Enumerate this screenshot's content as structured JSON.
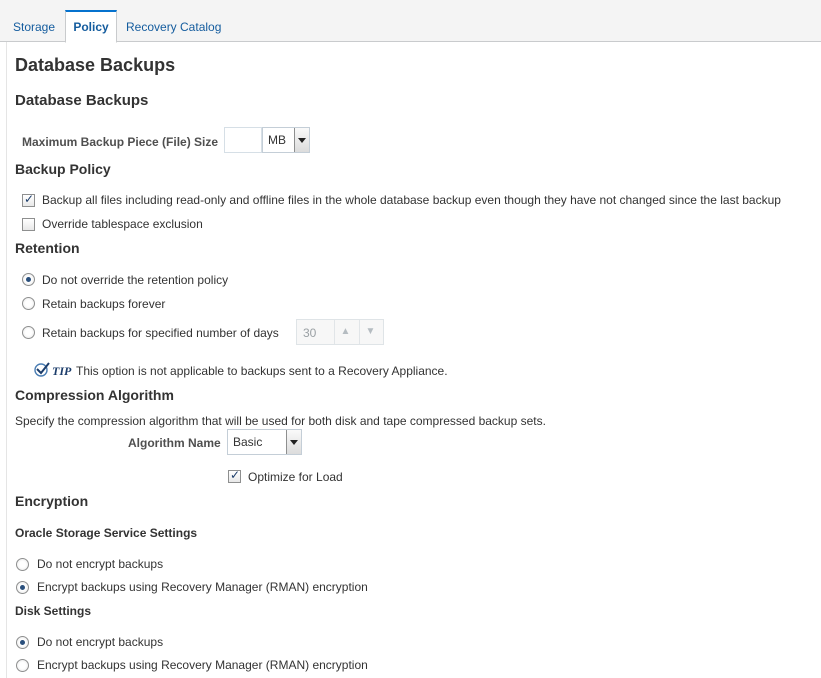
{
  "tabs": [
    {
      "label": "Storage",
      "active": false
    },
    {
      "label": "Policy",
      "active": true
    },
    {
      "label": "Recovery Catalog",
      "active": false
    }
  ],
  "page_title": "Database Backups",
  "section_title": "Database Backups",
  "max_piece": {
    "label": "Maximum Backup Piece (File) Size",
    "value": "",
    "unit": "MB"
  },
  "backup_policy": {
    "title": "Backup Policy",
    "backup_all": {
      "label": "Backup all files including read-only and offline files in the whole database backup even though they have not changed since the last backup",
      "checked": true
    },
    "override_tablespace": {
      "label": "Override tablespace exclusion",
      "checked": false
    }
  },
  "retention": {
    "title": "Retention",
    "options": [
      {
        "label": "Do not override the retention policy",
        "selected": true
      },
      {
        "label": "Retain backups forever",
        "selected": false
      },
      {
        "label": "Retain backups for specified number of days",
        "selected": false
      }
    ],
    "days_value": "30",
    "tip_label": "TIP",
    "tip_text": "This option is not applicable to backups sent to a Recovery Appliance."
  },
  "compression": {
    "title": "Compression Algorithm",
    "description": "Specify the compression algorithm that will be used for both disk and tape compressed backup sets.",
    "algorithm_label": "Algorithm Name",
    "algorithm_value": "Basic",
    "optimize": {
      "label": "Optimize for Load",
      "checked": true
    }
  },
  "encryption": {
    "title": "Encryption",
    "oracle_storage": {
      "title": "Oracle Storage Service Settings",
      "options": [
        {
          "label": "Do not encrypt backups",
          "selected": false
        },
        {
          "label": "Encrypt backups using Recovery Manager (RMAN) encryption",
          "selected": true
        }
      ]
    },
    "disk": {
      "title": "Disk Settings",
      "options": [
        {
          "label": "Do not encrypt backups",
          "selected": true
        },
        {
          "label": "Encrypt backups using Recovery Manager (RMAN) encryption",
          "selected": false
        }
      ]
    }
  },
  "colors": {
    "tab_link": "#145c9e",
    "tab_active_border": "#0572ce",
    "radio_selected": "#2a4f7c"
  },
  "icons": {
    "tip": "tip-check-icon",
    "dropdown": "chevron-down-icon",
    "spin_up": "chevron-up-icon",
    "spin_down": "chevron-down-icon"
  }
}
